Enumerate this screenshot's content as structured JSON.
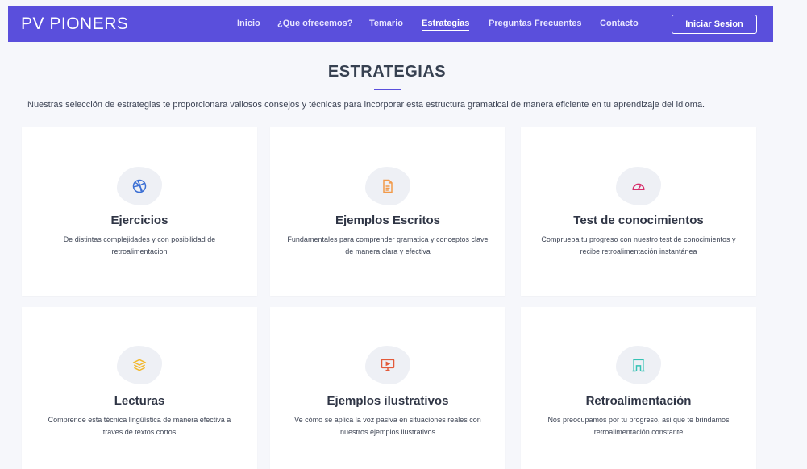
{
  "header": {
    "brand": "PV PIONERS",
    "nav": [
      "Inicio",
      "¿Que ofrecemos?",
      "Temario",
      "Estrategias",
      "Preguntas Frecuentes",
      "Contacto"
    ],
    "active": "Estrategias",
    "login_label": "Iniciar Sesion"
  },
  "section": {
    "title": "ESTRATEGIAS",
    "intro": "Nuestras selección de estrategias te proporcionara valiosos consejos y técnicas para incorporar esta estructura gramatical de manera eficiente en tu aprendizaje del idioma."
  },
  "cards": [
    {
      "title": "Ejercicios",
      "desc": "De distintas complejidades y con posibilidad de retroalimentacion",
      "icon": "dribbble-icon",
      "icon_color": "#3b6fd4"
    },
    {
      "title": "Ejemplos Escritos",
      "desc": "Fundamentales para comprender gramatica y conceptos clave de manera clara y efectiva",
      "icon": "file-text-icon",
      "icon_color": "#f29a4a"
    },
    {
      "title": "Test de conocimientos",
      "desc": "Comprueba tu progreso con nuestro test de conocimientos y recibe retroalimentación instantánea",
      "icon": "speedometer-icon",
      "icon_color": "#d62f6b"
    },
    {
      "title": "Lecturas",
      "desc": "Comprende esta técnica lingüística de manera efectiva a traves de textos cortos",
      "icon": "layers-icon",
      "icon_color": "#f2b82e"
    },
    {
      "title": "Ejemplos ilustrativos",
      "desc": "Ve cómo se aplica la voz pasiva en situaciones reales con nuestros ejemplos ilustrativos",
      "icon": "presentation-icon",
      "icon_color": "#e35a3a"
    },
    {
      "title": "Retroalimentación",
      "desc": "Nos preocupamos por tu progreso, asi que te brindamos retroalimentación constante",
      "icon": "archway-icon",
      "icon_color": "#35c2b4"
    }
  ],
  "colors": {
    "header_bg": "#5a4fdc",
    "page_bg": "#f6f7fb",
    "card_bg": "#ffffff",
    "blob_bg": "#eef0f5"
  }
}
